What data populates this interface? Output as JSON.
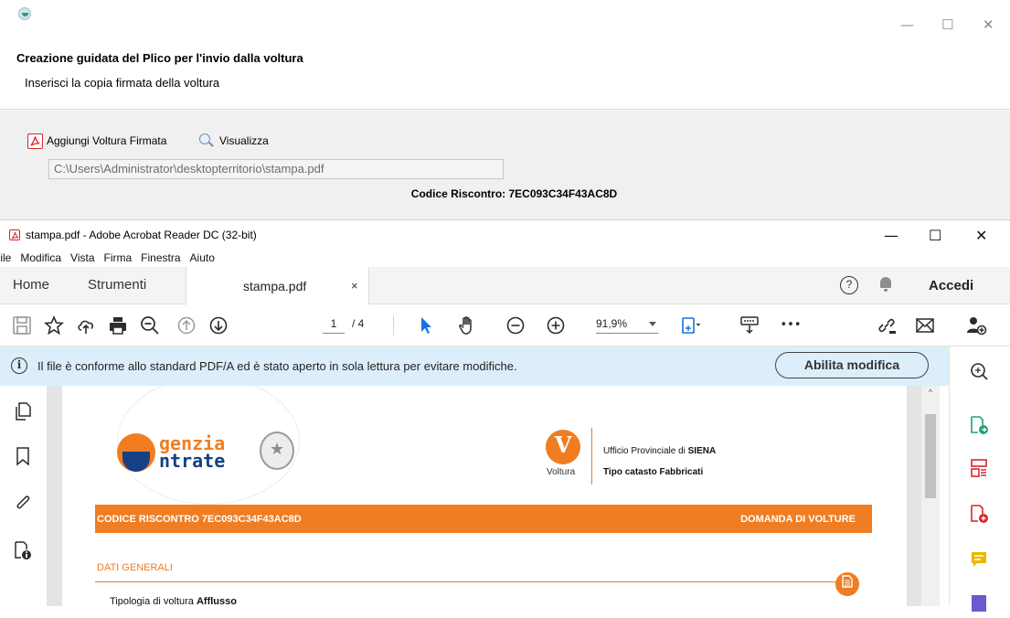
{
  "wizard": {
    "title": "Creazione guidata del Plico per l'invio dalla voltura",
    "subtitle": "Inserisci la copia firmata della voltura",
    "add_button_label": "Aggiungi Voltura Firmata",
    "view_button_label": "Visualizza",
    "file_path": "C:\\Users\\Administrator\\desktopterritorio\\stampa.pdf",
    "codice_riscontro": "Codice Riscontro: 7EC093C34F43AC8D",
    "window_controls": {
      "minimize": "—",
      "maximize": "☐",
      "close": "✕"
    }
  },
  "acrobat": {
    "window_title": "stampa.pdf - Adobe Acrobat Reader DC (32-bit)",
    "window_controls": {
      "minimize": "—",
      "maximize": "☐",
      "close": "✕"
    },
    "menu": [
      "File",
      "Modifica",
      "Vista",
      "Firma",
      "Finestra",
      "Aiuto"
    ],
    "tabs": {
      "home": "Home",
      "tools": "Strumenti",
      "document": "stampa.pdf",
      "close": "×"
    },
    "help_label": "?",
    "sign_in_label": "Accedi",
    "toolbar": {
      "current_page": "1",
      "page_total": "/ 4",
      "zoom": "91,9%",
      "more": "•••"
    },
    "notice": {
      "icon": "i",
      "text": "Il file è conforme allo standard PDF/A ed è stato aperto in sola lettura per evitare modifiche.",
      "button_label": "Abilita modifica"
    },
    "scroll_up": "^"
  },
  "pdf": {
    "logo_line1": "genzia",
    "logo_line2": "ntrate",
    "voltura_symbol": "V",
    "voltura_label": "Voltura",
    "ufficio_prefix": "Ufficio Provinciale di ",
    "ufficio_city": "SIENA",
    "tipo_catasto": "Tipo catasto Fabbricati",
    "band_left": "CODICE RISCONTRO 7EC093C34F43AC8D",
    "band_right": "DOMANDA DI VOLTURE",
    "section_title": "DATI GENERALI",
    "tipologia_label": "Tipologia di voltura ",
    "tipologia_value": "Afflusso"
  },
  "colors": {
    "accent_orange": "#f07d21",
    "agenzia_blue": "#173f84",
    "acrobat_red": "#d7262d",
    "notice_bg": "#ddeefb",
    "selection_blue": "#1473e6"
  },
  "icons": {
    "left_rail": [
      "page-thumbnails-icon",
      "bookmark-icon",
      "attachment-icon",
      "document-security-icon"
    ],
    "right_rail": [
      "zoom-panel-icon",
      "export-pdf-icon",
      "organize-pages-icon",
      "create-pdf-icon",
      "comment-icon"
    ]
  }
}
